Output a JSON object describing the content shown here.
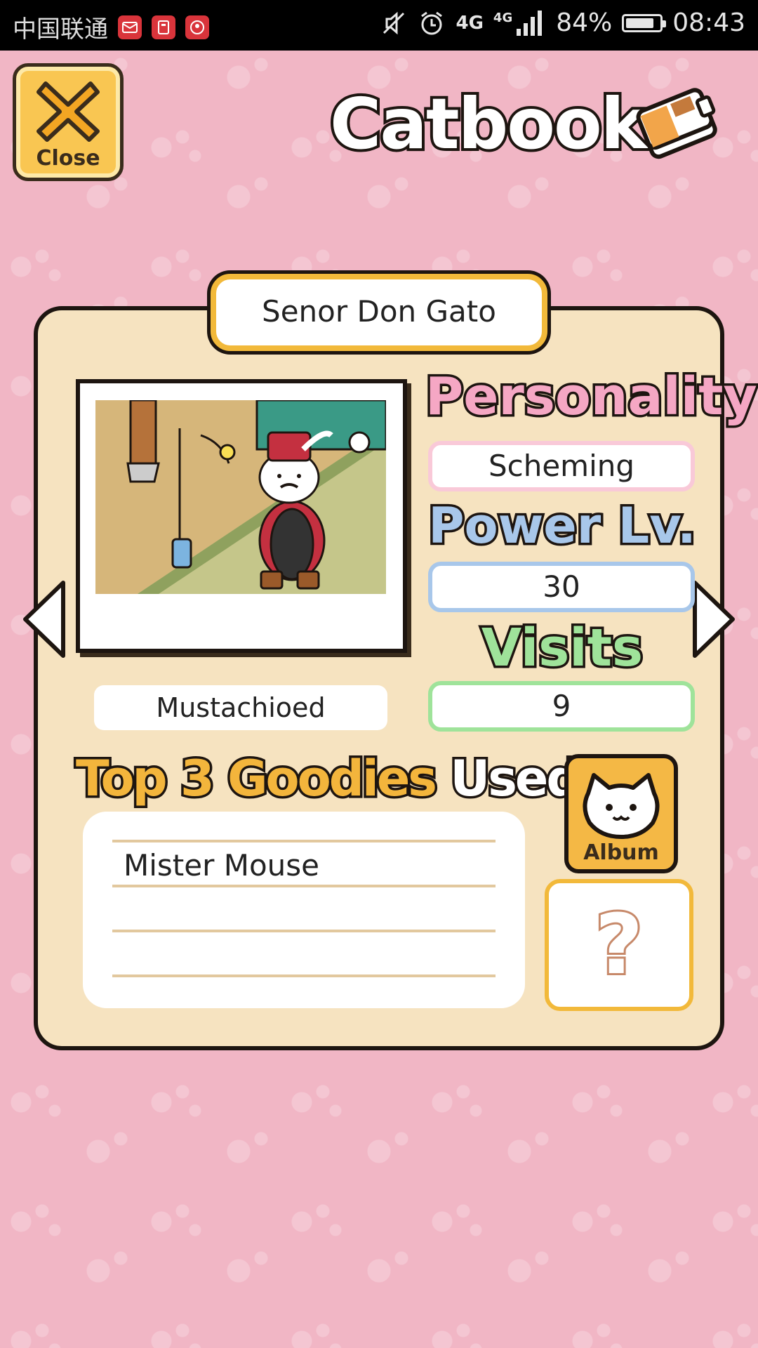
{
  "status_bar": {
    "carrier": "中国联通",
    "network_1": "4G",
    "network_2": "4G",
    "battery_percent": "84%",
    "battery_level": 0.84,
    "time": "08:43",
    "icons": [
      "mail-notification-icon",
      "clipboard-notification-icon",
      "app-notification-icon",
      "mute-icon",
      "alarm-icon",
      "signal-icon",
      "battery-icon"
    ]
  },
  "header": {
    "close_label": "Close",
    "title": "Catbook"
  },
  "cat": {
    "name": "Senor Don Gato",
    "trait": "Mustachioed",
    "personality_label": "Personality",
    "personality": "Scheming",
    "power_label": "Power Lv.",
    "power": "30",
    "visits_label": "Visits",
    "visits": "9"
  },
  "goodies": {
    "title_part1": "Top 3 Goodies",
    "title_part2": "Used",
    "items": [
      "Mister Mouse",
      "",
      ""
    ]
  },
  "buttons": {
    "album_label": "Album",
    "mystery_label": "?"
  },
  "colors": {
    "background": "#f1b6c5",
    "panel": "#f6e3c0",
    "accent_yellow": "#f2b93a",
    "personality": "#f5a7c4",
    "power": "#a8c7ea",
    "visits": "#9fe39a"
  }
}
